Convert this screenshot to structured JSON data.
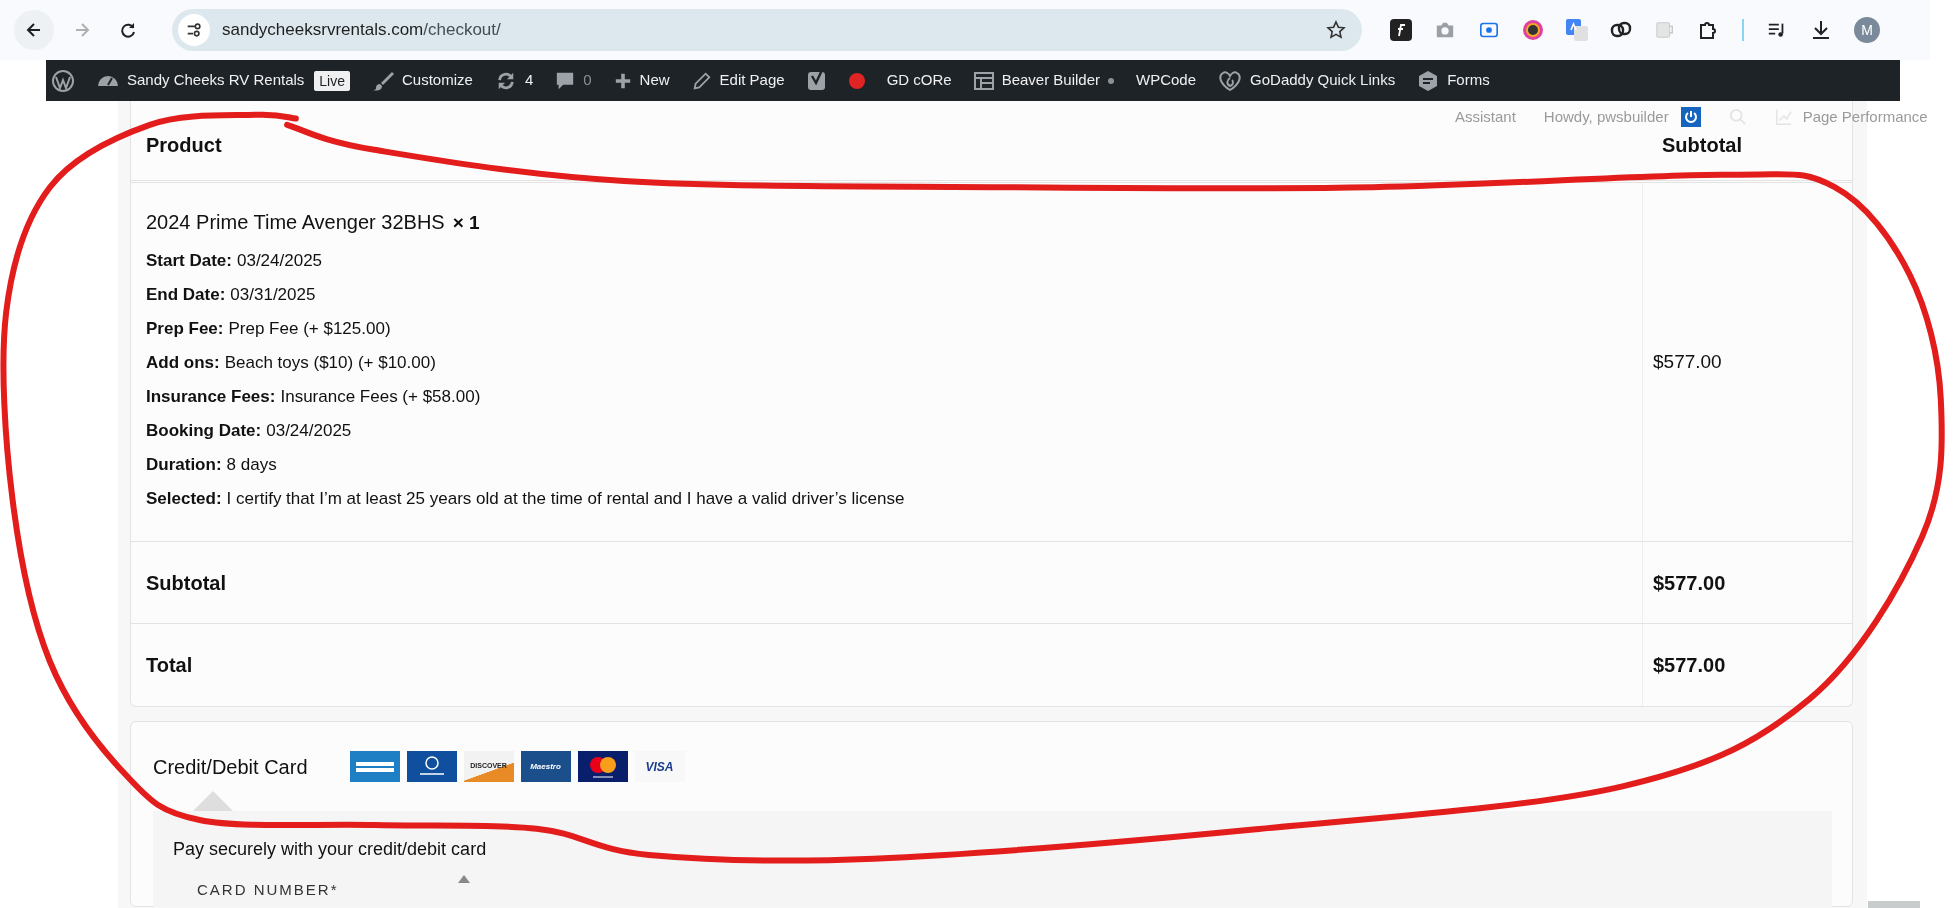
{
  "browser": {
    "forward_disabled": true,
    "url": {
      "domain": "sandycheeksrvrentals.com",
      "path": "/checkout/"
    },
    "profile_initial": "M"
  },
  "admin_bar": {
    "items": [
      {
        "kind": "wordpress"
      },
      {
        "kind": "site",
        "label": "Sandy Cheeks RV Rentals",
        "badge": "Live"
      },
      {
        "kind": "customize",
        "label": "Customize"
      },
      {
        "kind": "updates",
        "label": "4"
      },
      {
        "kind": "comments",
        "label": "0"
      },
      {
        "kind": "new",
        "label": "New"
      },
      {
        "kind": "edit",
        "label": "Edit Page"
      },
      {
        "kind": "seo"
      },
      {
        "kind": "status"
      },
      {
        "kind": "plain",
        "label": "GD cORe"
      },
      {
        "kind": "builder",
        "label": "Beaver Builder"
      },
      {
        "kind": "plain",
        "label": "WPCode"
      },
      {
        "kind": "godaddy",
        "label": "GoDaddy Quick Links"
      },
      {
        "kind": "forms",
        "label": "Forms"
      }
    ]
  },
  "hidden_bar": {
    "assistant": "Assistant",
    "greeting": "Howdy, pwsbuilder",
    "performance": "Page Performance"
  },
  "order_table": {
    "columns": [
      "Product",
      "Subtotal"
    ],
    "items": [
      {
        "name": "2024 Prime Time Avenger 32BHS",
        "quantity": "× 1",
        "subtotal": "$577.00",
        "meta": [
          {
            "label": "Start Date:",
            "value": "03/24/2025"
          },
          {
            "label": "End Date:",
            "value": "03/31/2025"
          },
          {
            "label": "Prep Fee:",
            "value": "Prep Fee (+ $125.00)"
          },
          {
            "label": "Add ons:",
            "value": "Beach toys ($10) (+ $10.00)"
          },
          {
            "label": "Insurance Fees:",
            "value": "Insurance Fees (+ $58.00)"
          },
          {
            "label": "Booking Date:",
            "value": "03/24/2025"
          },
          {
            "label": "Duration:",
            "value": "8 days"
          },
          {
            "label": "Selected:",
            "value": "I certify that I’m at least 25 years old at the time of rental and I have a valid driver’s license"
          }
        ]
      }
    ],
    "totals": [
      {
        "label": "Subtotal",
        "value": "$577.00"
      },
      {
        "label": "Total",
        "value": "$577.00"
      }
    ]
  },
  "payment": {
    "method": "Credit/Debit Card",
    "cards": [
      {
        "kind": "amex"
      },
      {
        "kind": "diners"
      },
      {
        "kind": "discover",
        "text": "DISCOVER"
      },
      {
        "kind": "maestro",
        "text": "Maestro"
      },
      {
        "kind": "mastercard"
      },
      {
        "kind": "visa",
        "text": "VISA"
      }
    ],
    "description": "Pay securely with your credit/debit card",
    "card_number_label": "CARD NUMBER*"
  }
}
